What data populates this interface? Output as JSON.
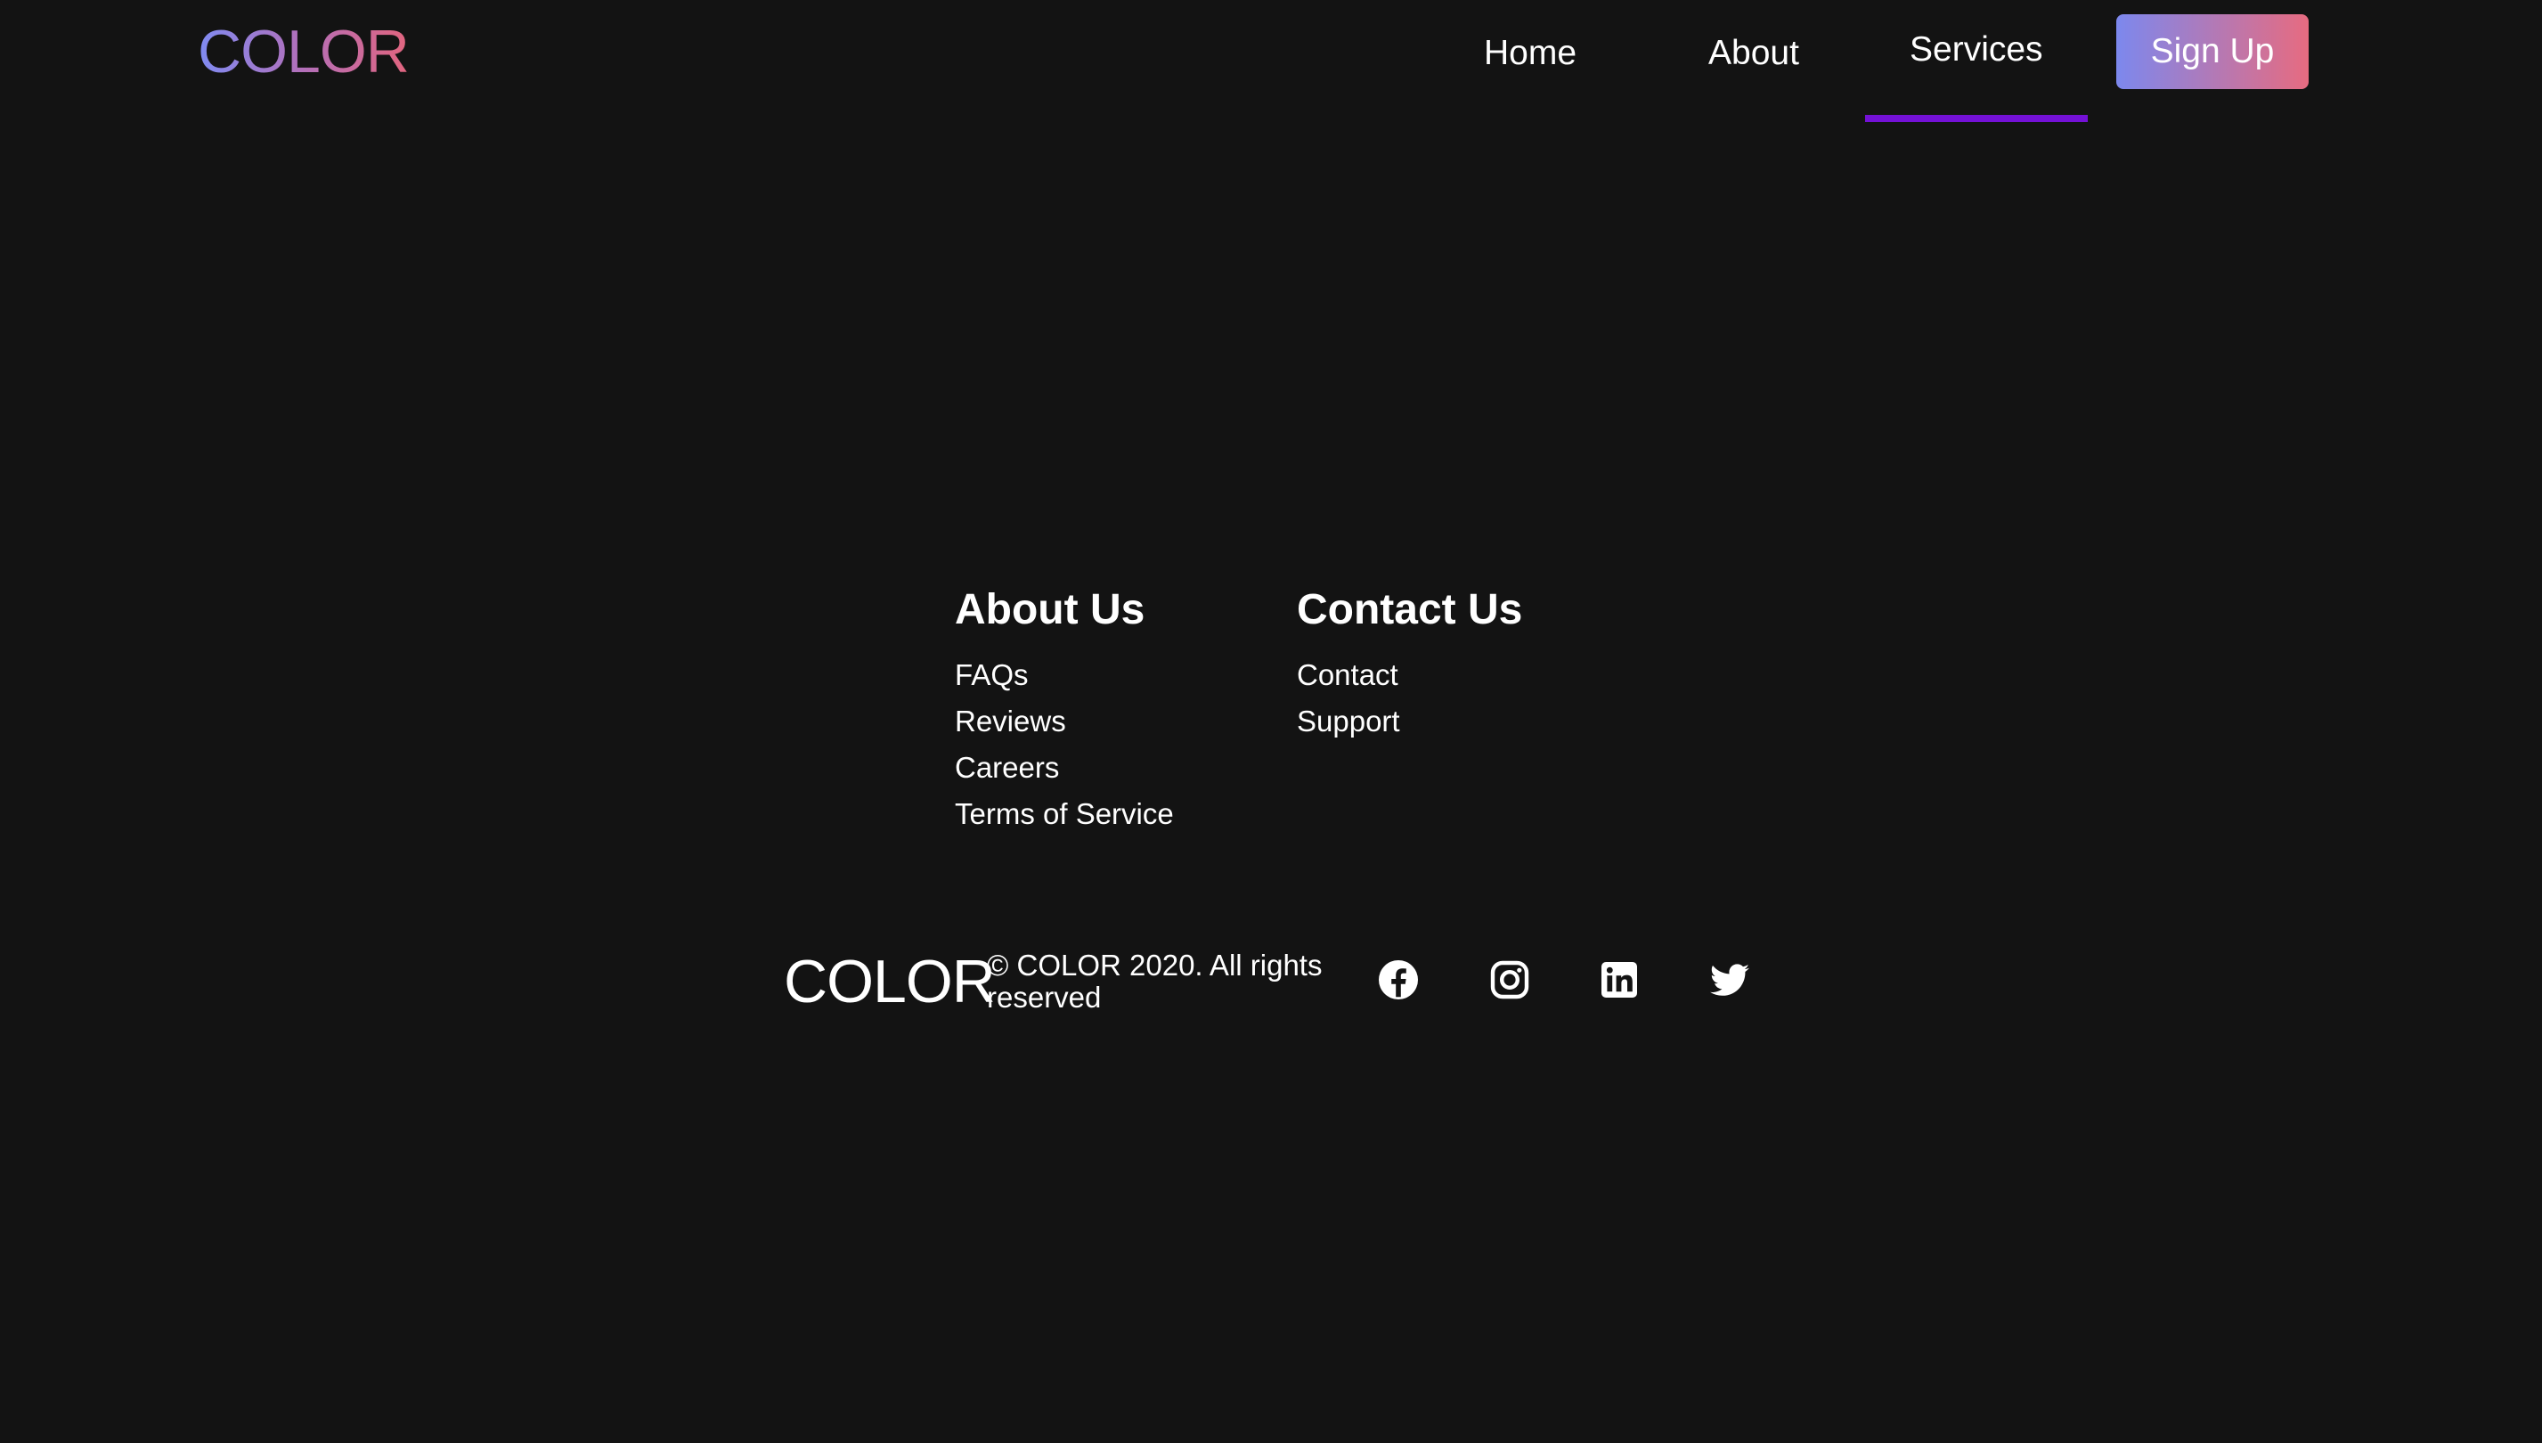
{
  "header": {
    "logo": "COLOR",
    "nav": {
      "home": "Home",
      "about": "About",
      "services": "Services"
    },
    "signup_label": "Sign Up",
    "active_tab": "Services"
  },
  "footer": {
    "about_heading": "About Us",
    "about_links": [
      "FAQs",
      "Reviews",
      "Careers",
      "Terms of Service"
    ],
    "contact_heading": "Contact Us",
    "contact_links": [
      "Contact",
      "Support"
    ],
    "logo": "COLOR",
    "copyright": "© COLOR 2020. All rights reserved",
    "social_icons": [
      "facebook-icon",
      "instagram-icon",
      "linkedin-icon",
      "twitter-icon"
    ]
  },
  "colors": {
    "background": "#131313",
    "active_underline": "#7411d6",
    "gradient_start": "#7c88ee",
    "gradient_end": "#e76b80"
  }
}
